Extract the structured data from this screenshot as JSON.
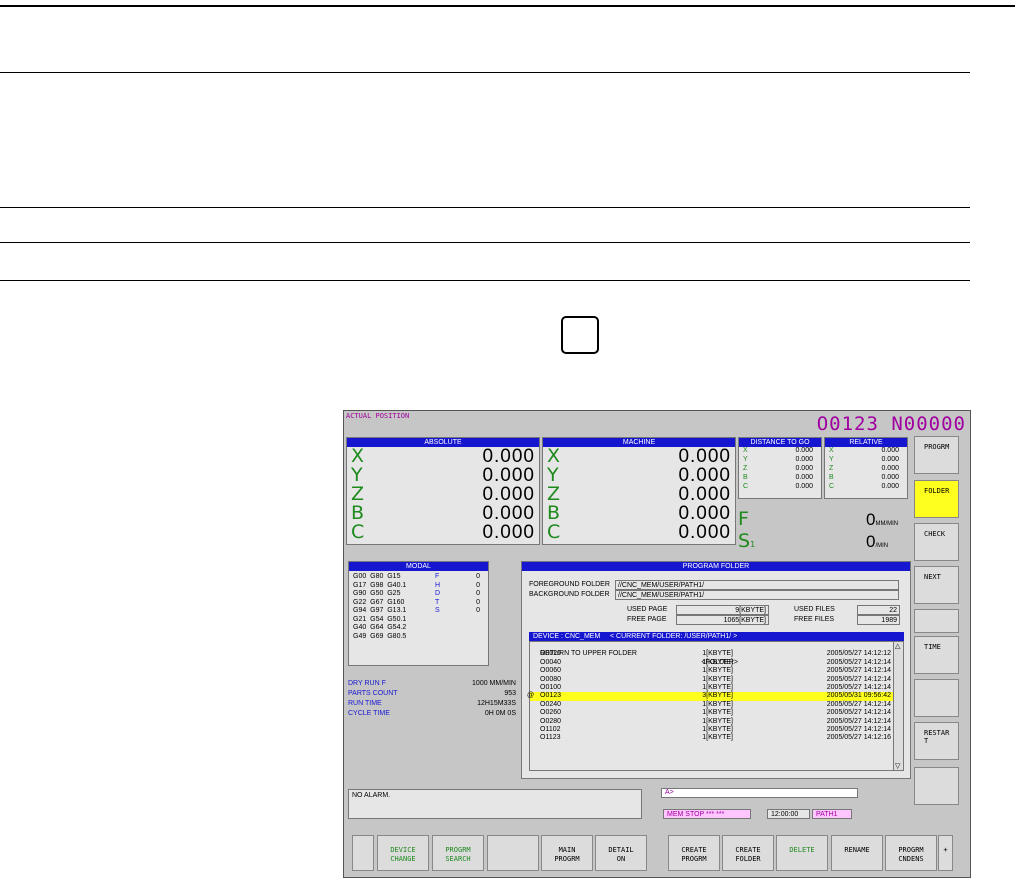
{
  "screen": {
    "title": "ACTUAL POSITION",
    "onum": "O0123 N00000",
    "absolute": {
      "header": "ABSOLUTE",
      "axes": [
        {
          "name": "X",
          "value": "0.000"
        },
        {
          "name": "Y",
          "value": "0.000"
        },
        {
          "name": "Z",
          "value": "0.000"
        },
        {
          "name": "B",
          "value": "0.000"
        },
        {
          "name": "C",
          "value": "0.000"
        }
      ]
    },
    "machine": {
      "header": "MACHINE",
      "axes": [
        {
          "name": "X",
          "value": "0.000"
        },
        {
          "name": "Y",
          "value": "0.000"
        },
        {
          "name": "Z",
          "value": "0.000"
        },
        {
          "name": "B",
          "value": "0.000"
        },
        {
          "name": "C",
          "value": "0.000"
        }
      ]
    },
    "dist_to_go": {
      "header": "DISTANCE TO GO",
      "axes": [
        {
          "name": "X",
          "value": "0.000"
        },
        {
          "name": "Y",
          "value": "0.000"
        },
        {
          "name": "Z",
          "value": "0.000"
        },
        {
          "name": "B",
          "value": "0.000"
        },
        {
          "name": "C",
          "value": "0.000"
        }
      ]
    },
    "relative": {
      "header": "RELATIVE",
      "axes": [
        {
          "name": "X",
          "value": "0.000"
        },
        {
          "name": "Y",
          "value": "0.000"
        },
        {
          "name": "Z",
          "value": "0.000"
        },
        {
          "name": "B",
          "value": "0.000"
        },
        {
          "name": "C",
          "value": "0.000"
        }
      ]
    },
    "feed": {
      "label": "F",
      "value": "0",
      "unit": "MM/MIN"
    },
    "spindle": {
      "label": "S",
      "sub": "1",
      "value": "0",
      "unit": "/MIN"
    },
    "modal": {
      "header": "MODAL",
      "rows": [
        {
          "codes": "G00  G80  G15",
          "key": "F",
          "val": "0"
        },
        {
          "codes": "G17  G98  G40.1",
          "key": "H",
          "val": "0"
        },
        {
          "codes": "G90  G50  G25",
          "key": "D",
          "val": "0"
        },
        {
          "codes": "G22  G67  G160",
          "key": "T",
          "val": "0"
        },
        {
          "codes": "G94  G97  G13.1",
          "key": "S",
          "val": "0"
        },
        {
          "codes": "G21  G54  G50.1",
          "key": "",
          "val": ""
        },
        {
          "codes": "G40  G64  G54.2",
          "key": "",
          "val": ""
        },
        {
          "codes": "G49  G69  G80.5",
          "key": "",
          "val": ""
        }
      ]
    },
    "info": [
      {
        "label": "DRY RUN F",
        "value": "1000 MM/MIN"
      },
      {
        "label": "PARTS COUNT",
        "value": "953"
      },
      {
        "label": "RUN TIME",
        "value": "12H15M33S"
      },
      {
        "label": "CYCLE TIME",
        "value": "0H 0M 0S"
      }
    ],
    "folder": {
      "header": "PROGRAM FOLDER",
      "fg_label": "FOREGROUND FOLDER",
      "fg_value": "//CNC_MEM/USER/PATH1/",
      "bg_label": "BACKGROUND FOLDER",
      "bg_value": "//CNC_MEM/USER/PATH1/",
      "used_page_label": "USED PAGE",
      "used_page": "9[KBYTE]",
      "free_page_label": "FREE PAGE",
      "free_page": "1065[KBYTE]",
      "used_files_label": "USED FILES",
      "used_files": "22",
      "free_files_label": "FREE FILES",
      "free_files": "1989",
      "device_bar": "DEVICE : CNC_MEM     < CURRENT FOLDER: /USER/PATH1/ >",
      "up_label": "RETURN TO UPPER FOLDER",
      "up_type": "<FOLDER>",
      "files": [
        {
          "mark": "",
          "name": "O0020",
          "size": "1[KBYTE]",
          "date": "2005/05/27 14:12:12"
        },
        {
          "mark": "",
          "name": "O0040",
          "size": "1[KBYTE]",
          "date": "2005/05/27 14:12:14"
        },
        {
          "mark": "",
          "name": "O0060",
          "size": "1[KBYTE]",
          "date": "2005/05/27 14:12:14"
        },
        {
          "mark": "",
          "name": "O0080",
          "size": "1[KBYTE]",
          "date": "2005/05/27 14:12:14"
        },
        {
          "mark": "",
          "name": "O0100",
          "size": "1[KBYTE]",
          "date": "2005/05/27 14:12:14"
        },
        {
          "mark": "@",
          "name": "O0123",
          "size": "3[KBYTE]",
          "date": "2005/05/31 09:56:42",
          "selected": true
        },
        {
          "mark": "",
          "name": "O0240",
          "size": "1[KBYTE]",
          "date": "2005/05/27 14:12:14"
        },
        {
          "mark": "",
          "name": "O0260",
          "size": "1[KBYTE]",
          "date": "2005/05/27 14:12:14"
        },
        {
          "mark": "",
          "name": "O0280",
          "size": "1[KBYTE]",
          "date": "2005/05/27 14:12:14"
        },
        {
          "mark": "",
          "name": "O1102",
          "size": "1[KBYTE]",
          "date": "2005/05/27 14:12:14"
        },
        {
          "mark": "",
          "name": "O1123",
          "size": "1[KBYTE]",
          "date": "2005/05/27 14:12:16"
        }
      ]
    },
    "message": "NO ALARM.",
    "input_prompt": "A>",
    "status": {
      "mode": "MEM  STOP *** ***",
      "time": "12:00:00",
      "path": "PATH1"
    },
    "soft_keys": [
      {
        "label": "PROGRM",
        "highlight": false
      },
      {
        "label": "FOLDER",
        "highlight": true
      },
      {
        "label": "CHECK",
        "highlight": false
      },
      {
        "label": "NEXT",
        "highlight": false
      },
      {
        "label": "",
        "highlight": false
      },
      {
        "label": "TIME",
        "highlight": false
      },
      {
        "label": "",
        "highlight": false
      },
      {
        "label": "RESTAR\nT",
        "highlight": false
      },
      {
        "label": "",
        "highlight": false
      }
    ],
    "hkeys": [
      {
        "label": "",
        "green": false
      },
      {
        "label": "DEVICE\nCHANGE",
        "green": true
      },
      {
        "label": "PROGRM\nSEARCH",
        "green": true
      },
      {
        "label": "",
        "green": false
      },
      {
        "label": "MAIN\nPROGRM",
        "green": false
      },
      {
        "label": "DETAIL\nON",
        "green": false
      },
      {
        "label": "CREATE\nPROGRM",
        "green": false
      },
      {
        "label": "CREATE\nFOLDER",
        "green": false
      },
      {
        "label": "DELETE",
        "green": true
      },
      {
        "label": "RENAME",
        "green": false
      },
      {
        "label": "PROGRM\nCNDENS",
        "green": false
      },
      {
        "label": "+",
        "green": false
      }
    ]
  }
}
